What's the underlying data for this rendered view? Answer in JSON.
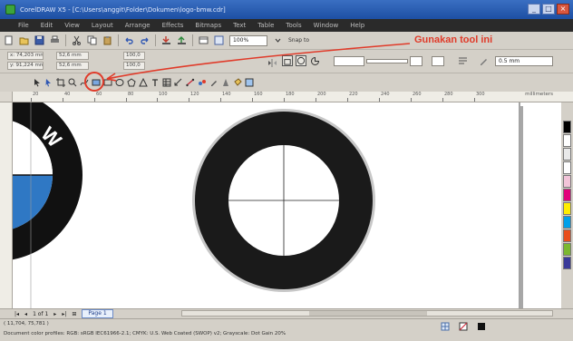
{
  "window": {
    "title": "CorelDRAW X5 - [C:\\Users\\anggit\\Folder\\Dokumen\\logo-bmw.cdr]",
    "minimize": "_",
    "maximize": "□",
    "close": "×"
  },
  "menu": {
    "items": [
      "File",
      "Edit",
      "View",
      "Layout",
      "Arrange",
      "Effects",
      "Bitmaps",
      "Text",
      "Table",
      "Tools",
      "Window",
      "Help"
    ]
  },
  "toolbar1": {
    "zoom": "100%",
    "snap_label": "Snap to"
  },
  "annotation": {
    "text": "Gunakan tool ini",
    "color": "#e03b2a"
  },
  "property_bar": {
    "x": "x: 74,203 mm",
    "y": "y: 91,224 mm",
    "width": "52,6 mm",
    "height": "52,6 mm",
    "scale_w": "100,0",
    "scale_h": "100,0",
    "outline": "0.5 mm"
  },
  "ruler": {
    "labels": [
      "20",
      "40",
      "60",
      "80",
      "100",
      "120",
      "140",
      "160",
      "180",
      "200",
      "220",
      "240",
      "260",
      "280",
      "300"
    ],
    "unit": "millimeters"
  },
  "pagenav": {
    "page_count": "1 of 1",
    "page_tab": "Page 1"
  },
  "status": {
    "coords": "( 11,704, 75,781 )",
    "doc_info": "Document color profiles: RGB: sRGB IEC61966-2.1; CMYK: U.S. Web Coated (SWOP) v2; Grayscale: Dot Gain 20%"
  },
  "palette": {
    "colors": [
      "#000000",
      "#ffffff",
      "#e9e9e9",
      "#ffffff",
      "#f2c4d8",
      "#e2007a",
      "#ffed00",
      "#00a0e9",
      "#e94e1b",
      "#7cb82f",
      "#3a3a99",
      "#f39800",
      "#e5004f",
      "#009944"
    ]
  },
  "colors": {
    "ring": "#1a1a1a",
    "ring_border": "#b5b5b5",
    "bmw_blue": "#2f78c4"
  }
}
